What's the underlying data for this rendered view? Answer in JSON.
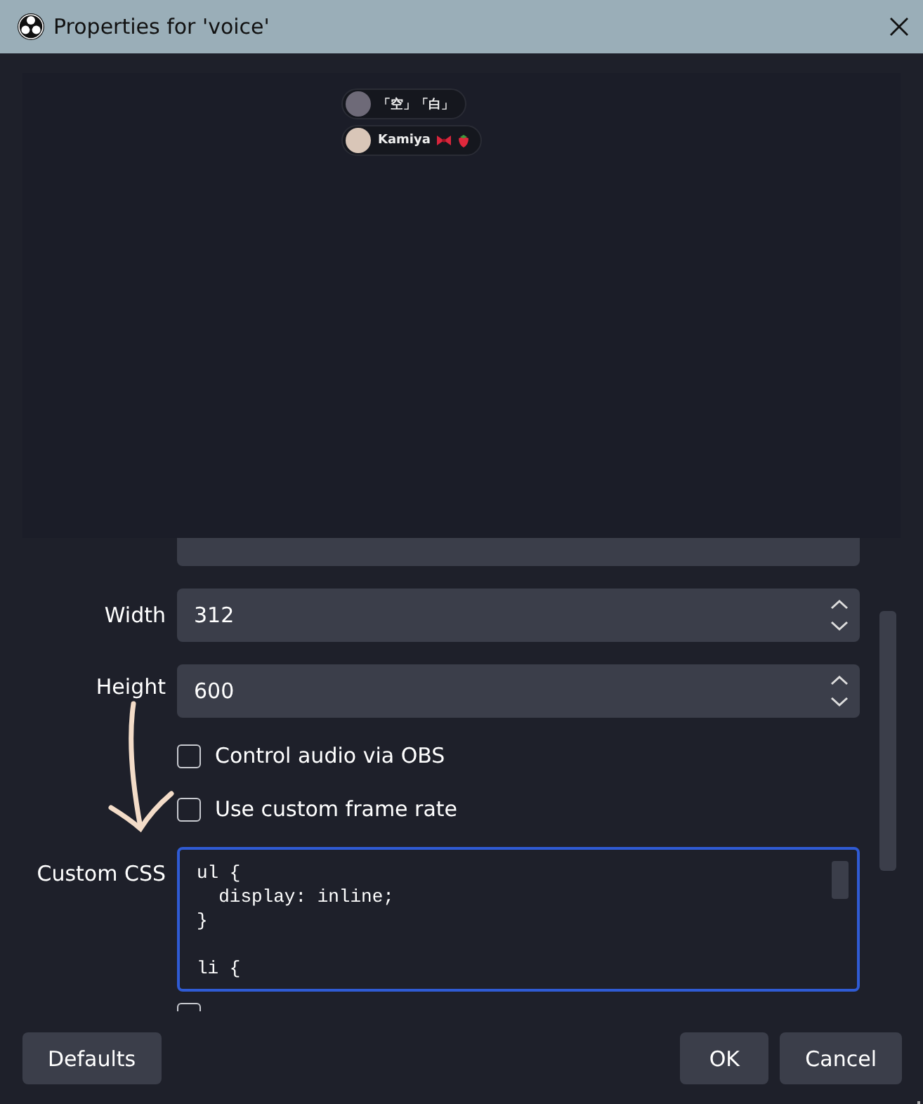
{
  "window": {
    "title": "Properties for 'voice'"
  },
  "preview": {
    "participants": [
      {
        "name": "「空」「白」"
      },
      {
        "name": "Kamiya",
        "badges": [
          {
            "kind": "bow"
          },
          {
            "kind": "strawberry"
          }
        ]
      }
    ]
  },
  "properties": [
    {
      "kind": "field"
    },
    {
      "kind": "spin",
      "label": "Width",
      "value": "312"
    },
    {
      "kind": "spin",
      "label": "Height",
      "value": "600"
    },
    {
      "kind": "checkbox",
      "label": "Control audio via OBS",
      "checked": false
    },
    {
      "kind": "checkbox",
      "label": "Use custom frame rate",
      "checked": false
    },
    {
      "kind": "code",
      "label": "Custom CSS",
      "value": "ul {\n  display: inline;\n}\n\nli {"
    },
    {
      "kind": "checkbox",
      "checked": false
    }
  ],
  "buttons": [
    "Defaults",
    "OK",
    "Cancel"
  ]
}
